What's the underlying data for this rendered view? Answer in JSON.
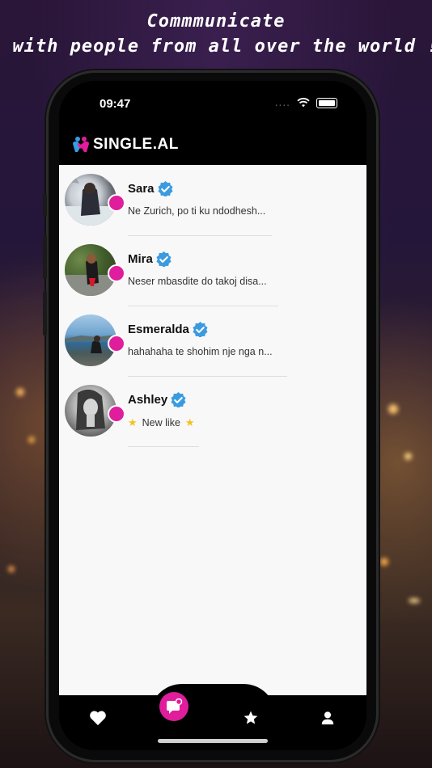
{
  "promo": {
    "line1": "Commmunicate",
    "line2": "with people from all over the world !"
  },
  "status": {
    "time": "09:47",
    "signal_dots": "...."
  },
  "brand": {
    "name": "SINGLE.AL",
    "icon": "couple-heart-icon"
  },
  "colors": {
    "accent": "#e01d9c",
    "verified": "#3a9be0",
    "background": "#f8f8f8"
  },
  "chats": [
    {
      "name": "Sara",
      "message": "Ne Zurich, po ti ku ndodhesh...",
      "verified": true,
      "online": true
    },
    {
      "name": "Mira",
      "message": "Neser mbasdite do takoj disa...",
      "verified": true,
      "online": true
    },
    {
      "name": "Esmeralda",
      "message": "hahahaha te shohim nje nga n...",
      "verified": true,
      "online": true
    },
    {
      "name": "Ashley",
      "message": "New like",
      "verified": true,
      "online": true
    }
  ],
  "tabs": [
    {
      "id": "likes",
      "icon": "heart-icon"
    },
    {
      "id": "chat",
      "icon": "chat-icon",
      "active": true
    },
    {
      "id": "favorites",
      "icon": "star-icon"
    },
    {
      "id": "profile",
      "icon": "person-icon"
    }
  ]
}
